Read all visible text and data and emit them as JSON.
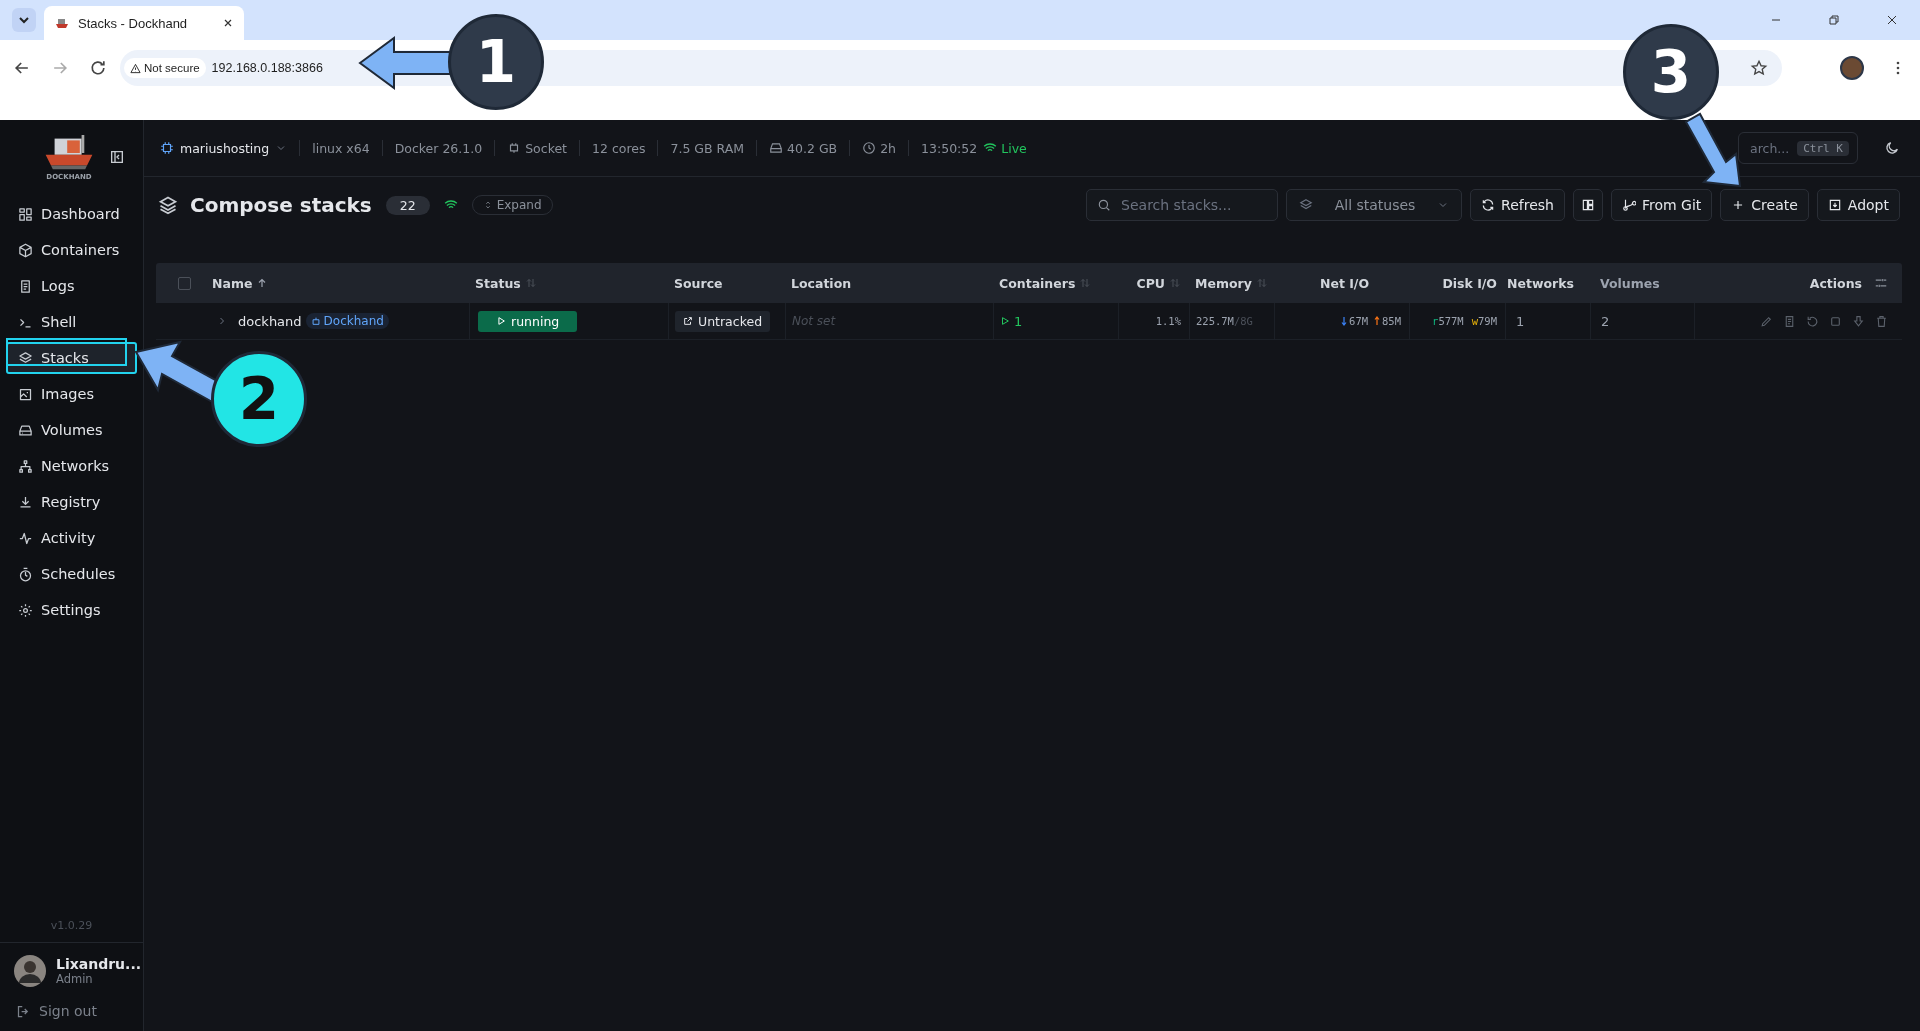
{
  "browser": {
    "tab_title": "Stacks - Dockhand",
    "security": "Not secure",
    "url": "192.168.0.188:3866"
  },
  "sidebar": {
    "logo_text": "DOCKHAND",
    "items": [
      {
        "label": "Dashboard",
        "selected": false
      },
      {
        "label": "Containers",
        "selected": false
      },
      {
        "label": "Logs",
        "selected": false
      },
      {
        "label": "Shell",
        "selected": false
      },
      {
        "label": "Stacks",
        "selected": true
      },
      {
        "label": "Images",
        "selected": false
      },
      {
        "label": "Volumes",
        "selected": false
      },
      {
        "label": "Networks",
        "selected": false
      },
      {
        "label": "Registry",
        "selected": false
      },
      {
        "label": "Activity",
        "selected": false
      },
      {
        "label": "Schedules",
        "selected": false
      },
      {
        "label": "Settings",
        "selected": false
      }
    ],
    "version": "v1.0.29",
    "user": {
      "name": "Lixandru...",
      "role": "Admin"
    },
    "sign_out": "Sign out"
  },
  "topbar": {
    "host": "mariushosting",
    "stats": [
      "linux x64",
      "Docker 26.1.0",
      "Socket",
      "12 cores",
      "7.5 GB RAM",
      "40.2 GB",
      "2h",
      "13:50:52"
    ],
    "live": "Live",
    "search_placeholder": "arch...",
    "shortcut": "Ctrl K"
  },
  "page": {
    "title": "Compose stacks",
    "count": "22",
    "expand": "Expand",
    "search_placeholder": "Search stacks...",
    "status_filter": "All statuses",
    "buttons": [
      {
        "kind": "text",
        "label": "Refresh"
      },
      {
        "kind": "icon"
      },
      {
        "kind": "text",
        "label": "From Git"
      },
      {
        "kind": "text",
        "label": "Create"
      },
      {
        "kind": "text",
        "label": "Adopt"
      }
    ]
  },
  "table": {
    "select_all_checked": false,
    "columns": [
      {
        "label": "Name",
        "sortable": true,
        "sorted": true
      },
      {
        "label": "Status",
        "sortable": true,
        "sorted": false
      },
      {
        "label": "Source",
        "sortable": false,
        "sorted": false
      },
      {
        "label": "Location",
        "sortable": false,
        "sorted": false
      },
      {
        "label": "Containers",
        "sortable": true,
        "sorted": false
      },
      {
        "label": "CPU",
        "sortable": true,
        "sorted": false
      },
      {
        "label": "Memory",
        "sortable": true,
        "sorted": false
      },
      {
        "label": "Net I/O",
        "sortable": false,
        "sorted": false
      },
      {
        "label": "Disk I/O",
        "sortable": false,
        "sorted": false
      },
      {
        "label": "Networks",
        "sortable": false,
        "sorted": false
      },
      {
        "label": "Volumes",
        "sortable": false,
        "sorted": false
      },
      {
        "label": "Actions",
        "sortable": false,
        "sorted": false
      }
    ],
    "rows": [
      {
        "expanded": false,
        "name": "dockhand",
        "tag": "Dockhand",
        "status": "running",
        "source": "Untracked",
        "location": "Not set",
        "containers": "1",
        "cpu": "1.1%",
        "memory": "225.7M",
        "memory_limit": "/8G",
        "net_down": "67M",
        "net_up": "85M",
        "disk_read_mark": "r",
        "disk_read": "577M",
        "disk_write_mark": "w",
        "disk_write": "79M",
        "networks": "1",
        "volumes": "2"
      }
    ]
  },
  "annotations": [
    {
      "label": "1"
    },
    {
      "label": "2"
    },
    {
      "label": "3"
    }
  ]
}
